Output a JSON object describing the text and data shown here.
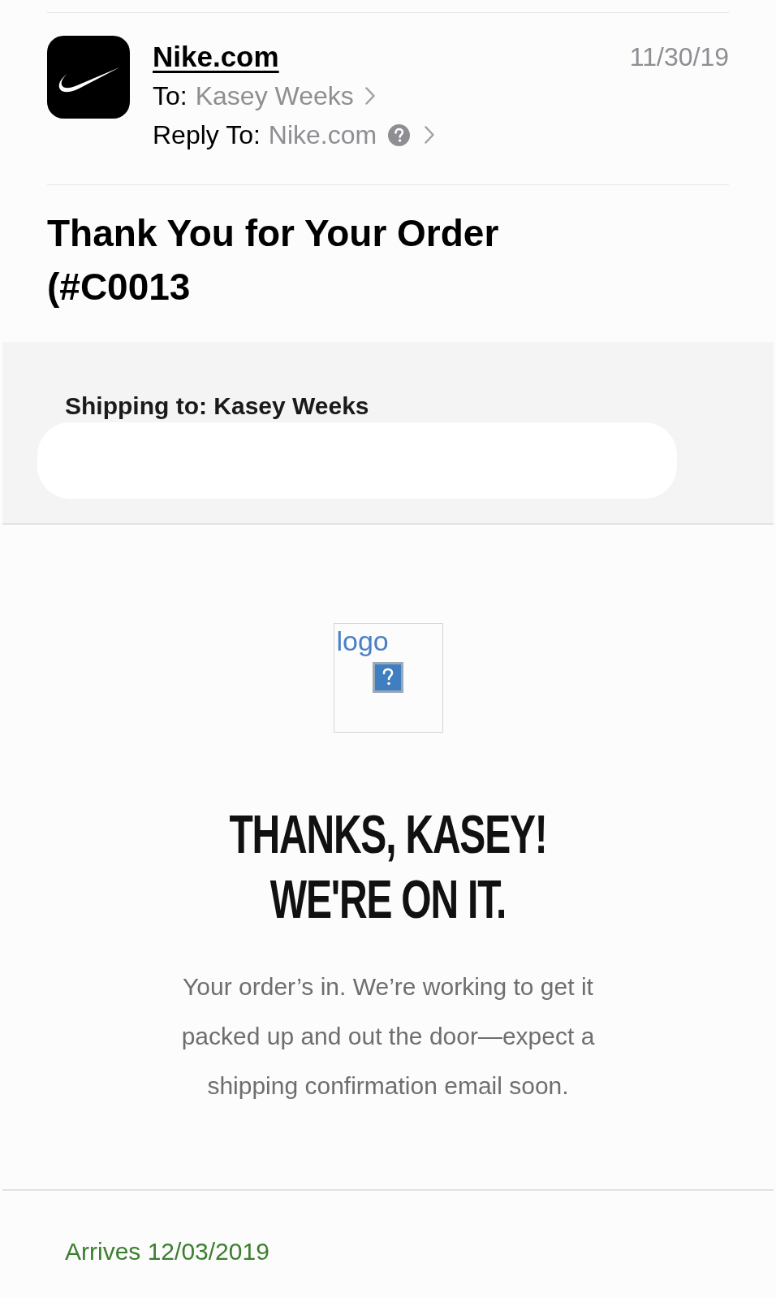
{
  "message_header": {
    "sender": "Nike.com",
    "date": "11/30/19",
    "to": {
      "label": "To:",
      "value": "Kasey Weeks"
    },
    "reply_to": {
      "label": "Reply To:",
      "value": "Nike.com"
    }
  },
  "subject": "Thank You for Your Order (#C0013",
  "shipping": {
    "heading": "Shipping to: Kasey Weeks"
  },
  "logo_image": {
    "alt_text": "logo"
  },
  "headline": "THANKS, KASEY! WE'RE ON IT.",
  "body": "Your order’s in. We’re working to get it packed up and out the door—expect a shipping confirmation email soon.",
  "delivery": {
    "estimate": "Arrives 12/03/2019"
  }
}
